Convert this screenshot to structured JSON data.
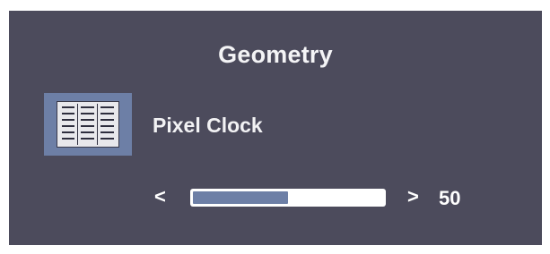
{
  "menu": {
    "title": "Geometry"
  },
  "item": {
    "icon": "pixel-clock-grid-icon",
    "label": "Pixel Clock"
  },
  "slider": {
    "left_arrow": "<",
    "right_arrow": ">",
    "value": "50",
    "fill_fraction": 0.5
  },
  "colors": {
    "background": "#4c4b5c",
    "accent": "#6d7fa6",
    "track": "#ffffff",
    "text": "#ffffff"
  }
}
